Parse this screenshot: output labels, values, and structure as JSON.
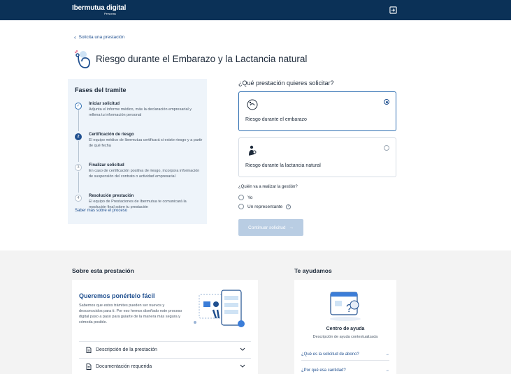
{
  "header": {
    "logo_text": "Ibermutua digital",
    "logo_sub": "Personas",
    "logout_icon": "logout-icon"
  },
  "breadcrumb": {
    "back_label": "Solicita una prestación"
  },
  "page": {
    "title": "Riesgo durante el Embarazo y la Lactancia natural",
    "icon": "pregnancy-icon"
  },
  "phases": {
    "title": "Fases del tramite",
    "items": [
      {
        "num": "✓",
        "state": "done",
        "title": "Iniciar solicitud",
        "desc": "Adjunta el informe médico, más la declaración empresarial y rellena tu información personal"
      },
      {
        "num": "2",
        "state": "active",
        "title": "Certificación de riesgo",
        "desc": "El equipo médico de Ibermutua certificará si existe riesgo y a partir de qué fecha"
      },
      {
        "num": "3",
        "state": "pending",
        "title": "Finalizar solicitud",
        "desc": "En caso de certificación positiva de riesgo, incorpora información de suspensión del contrato o actividad empresarial"
      },
      {
        "num": "4",
        "state": "pending",
        "title": "Resolución prestación",
        "desc": "El equipo de Prestaciones de Ibermutua te comunicará la resolución final sobre tu prestación"
      }
    ],
    "more_link": "Saber más sobre el proceso"
  },
  "form": {
    "question": "¿Qué prestación quieres solicitar?",
    "options": [
      {
        "label": "Riesgo durante el embarazo",
        "selected": true,
        "icon": "pregnant-belly-icon"
      },
      {
        "label": "Riesgo durante la lactancia natural",
        "selected": false,
        "icon": "mother-baby-icon"
      }
    ],
    "who_question": "¿Quién va a realizar la gestión?",
    "who_options": [
      "Yo",
      "Un representante"
    ],
    "continue_label": "Continuar solicitud"
  },
  "about": {
    "heading": "Sobre esta prestación",
    "card_title": "Queremos ponértelo fácil",
    "card_text": "Sabemos que estos trámites pueden ser nuevos y desconocidos para ti. Por eso hemos diseñado este proceso digital paso a paso para guiarte de la manera más segura y cómoda posible.",
    "accordions": [
      "Descripción de la prestación",
      "Documentación requerida"
    ]
  },
  "help": {
    "heading": "Te ayudamos",
    "title": "Centro de ayuda",
    "subtitle": "Descripción de ayuda contextualizada",
    "links": [
      "¿Qué es la solicitud de abono?",
      "¿Por qué esa cantidad?"
    ]
  },
  "colors": {
    "brand": "#0b3157",
    "accent": "#1f4f8f",
    "disabled_button": "#b9cde3"
  }
}
